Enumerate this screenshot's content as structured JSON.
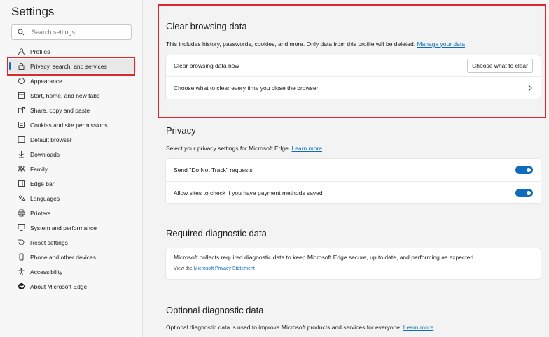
{
  "sidebar": {
    "title": "Settings",
    "search_placeholder": "Search settings",
    "items": [
      {
        "label": "Profiles",
        "icon": "profile-icon"
      },
      {
        "label": "Privacy, search, and services",
        "icon": "lock-icon",
        "active": true
      },
      {
        "label": "Appearance",
        "icon": "appearance-icon"
      },
      {
        "label": "Start, home, and new tabs",
        "icon": "home-icon"
      },
      {
        "label": "Share, copy and paste",
        "icon": "share-icon"
      },
      {
        "label": "Cookies and site permissions",
        "icon": "cookie-icon"
      },
      {
        "label": "Default browser",
        "icon": "browser-icon"
      },
      {
        "label": "Downloads",
        "icon": "download-icon"
      },
      {
        "label": "Family",
        "icon": "family-icon"
      },
      {
        "label": "Edge bar",
        "icon": "edge-bar-icon"
      },
      {
        "label": "Languages",
        "icon": "language-icon"
      },
      {
        "label": "Printers",
        "icon": "printer-icon"
      },
      {
        "label": "System and performance",
        "icon": "system-icon"
      },
      {
        "label": "Reset settings",
        "icon": "reset-icon"
      },
      {
        "label": "Phone and other devices",
        "icon": "phone-icon"
      },
      {
        "label": "Accessibility",
        "icon": "accessibility-icon"
      },
      {
        "label": "About Microsoft Edge",
        "icon": "edge-logo-icon"
      }
    ]
  },
  "clear": {
    "title": "Clear browsing data",
    "desc": "This includes history, passwords, cookies, and more. Only data from this profile will be deleted.",
    "manage_link": "Manage your data",
    "row1_label": "Clear browsing data now",
    "row1_button": "Choose what to clear",
    "row2_label": "Choose what to clear every time you close the browser"
  },
  "privacy": {
    "title": "Privacy",
    "desc": "Select your privacy settings for Microsoft Edge.",
    "learn_more": "Learn more",
    "dnt_label": "Send \"Do Not Track\" requests",
    "dnt_on": true,
    "payment_label": "Allow sites to check if you have payment methods saved",
    "payment_on": true
  },
  "required": {
    "title": "Required diagnostic data",
    "text": "Microsoft collects required diagnostic data to keep Microsoft Edge secure, up to date, and performing as expected",
    "view_the": "View the",
    "privacy_link": "Microsoft Privacy Statement"
  },
  "optional": {
    "title": "Optional diagnostic data",
    "desc": "Optional diagnostic data is used to improve Microsoft products and services for everyone.",
    "learn_more": "Learn more"
  },
  "colors": {
    "accent": "#0f6cbd",
    "highlight": "#e0262d"
  }
}
